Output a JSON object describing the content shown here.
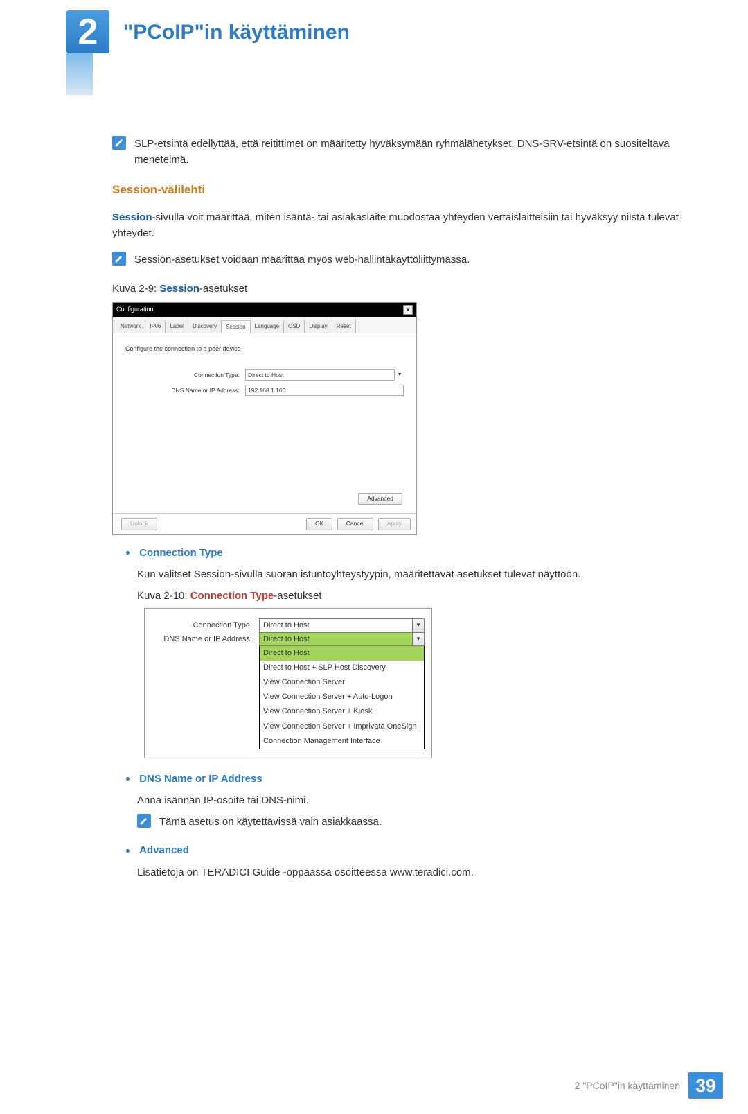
{
  "chapter": {
    "number": "2",
    "title": "\"PCoIP\"in käyttäminen"
  },
  "intro_note": "SLP-etsintä edellyttää, että reitittimet on määritetty hyväksymään ryhmälähetykset. DNS-SRV-etsintä on suositeltava menetelmä.",
  "section_heading": "Session-välilehti",
  "section_body_prefix": "Session",
  "section_body_rest": "-sivulla voit määrittää, miten isäntä- tai asiakaslaite muodostaa yhteyden vertaislaitteisiin tai hyväksyy niistä tulevat yhteydet.",
  "section_note": "Session-asetukset voidaan määrittää myös web-hallintakäyttöliittymässä.",
  "fig2_9": {
    "caption_prefix": "Kuva 2-9: ",
    "caption_mid": "Session",
    "caption_suffix": "-asetukset",
    "dialog_title": "Configuration",
    "tabs": [
      "Network",
      "IPv6",
      "Label",
      "Discovery",
      "Session",
      "Language",
      "OSD",
      "Display",
      "Reset"
    ],
    "active_tab_index": 4,
    "instruction": "Configure the connection to a peer device",
    "row1_label": "Connection Type:",
    "row1_value": "Direct to Host",
    "row2_label": "DNS Name or IP Address:",
    "row2_value": "192.168.1.100",
    "advanced_btn": "Advanced",
    "unlock_btn": "Unlock",
    "ok_btn": "OK",
    "cancel_btn": "Cancel",
    "apply_btn": "Apply"
  },
  "bullets": {
    "conn_type": {
      "heading": "Connection Type",
      "body": "Kun valitset Session-sivulla suoran istuntoyhteystyypin, määritettävät asetukset tulevat näyttöön."
    },
    "fig2_10": {
      "caption_prefix": "Kuva 2-10: ",
      "caption_mid": "Connection Type",
      "caption_suffix": "-asetukset",
      "row1_label": "Connection Type:",
      "row1_value": "Direct to Host",
      "row2_label": "DNS Name or IP Address:",
      "selected": "Direct to Host",
      "options": [
        "Direct to Host",
        "Direct to Host + SLP Host Discovery",
        "View Connection Server",
        "View Connection Server + Auto-Logon",
        "View Connection Server + Kiosk",
        "View Connection Server + Imprivata OneSign",
        "Connection Management Interface"
      ]
    },
    "dns": {
      "heading": "DNS Name or IP Address",
      "body": "Anna isännän IP-osoite tai DNS-nimi.",
      "note": "Tämä asetus on käytettävissä vain asiakkaassa."
    },
    "advanced": {
      "heading": "Advanced",
      "body": "Lisätietoja on TERADICI Guide -oppaassa osoitteessa www.teradici.com."
    }
  },
  "footer": {
    "text": "2 \"PCoIP\"in käyttäminen",
    "page": "39"
  }
}
